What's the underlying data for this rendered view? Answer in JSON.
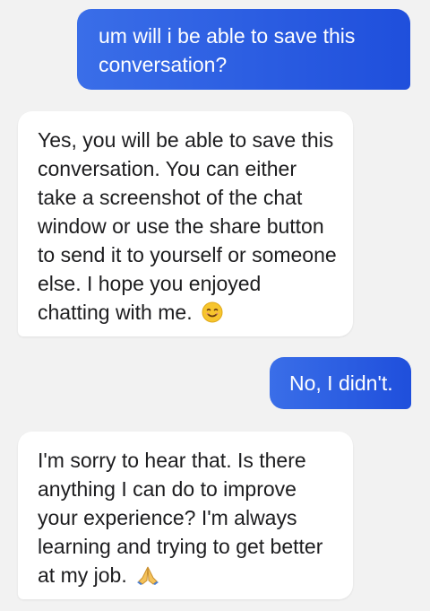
{
  "messages": [
    {
      "sender": "user",
      "text": "um will i be able to save this conversation?"
    },
    {
      "sender": "bot",
      "text": "Yes, you will be able to save this conversation. You can either take a screenshot of the chat window or use the share button to send it to yourself or someone else. I hope you enjoyed chatting with me.",
      "emoji": "smiling-face-icon"
    },
    {
      "sender": "user",
      "text": "No, I didn't."
    },
    {
      "sender": "bot",
      "text": "I'm sorry to hear that. Is there anything I can do to improve your experience? I'm always learning and trying to get better at my job.",
      "emoji": "folded-hands-icon"
    }
  ],
  "colors": {
    "user_bubble": "#1f4fdc",
    "bot_bubble": "#ffffff",
    "background": "#f2f2f2"
  }
}
